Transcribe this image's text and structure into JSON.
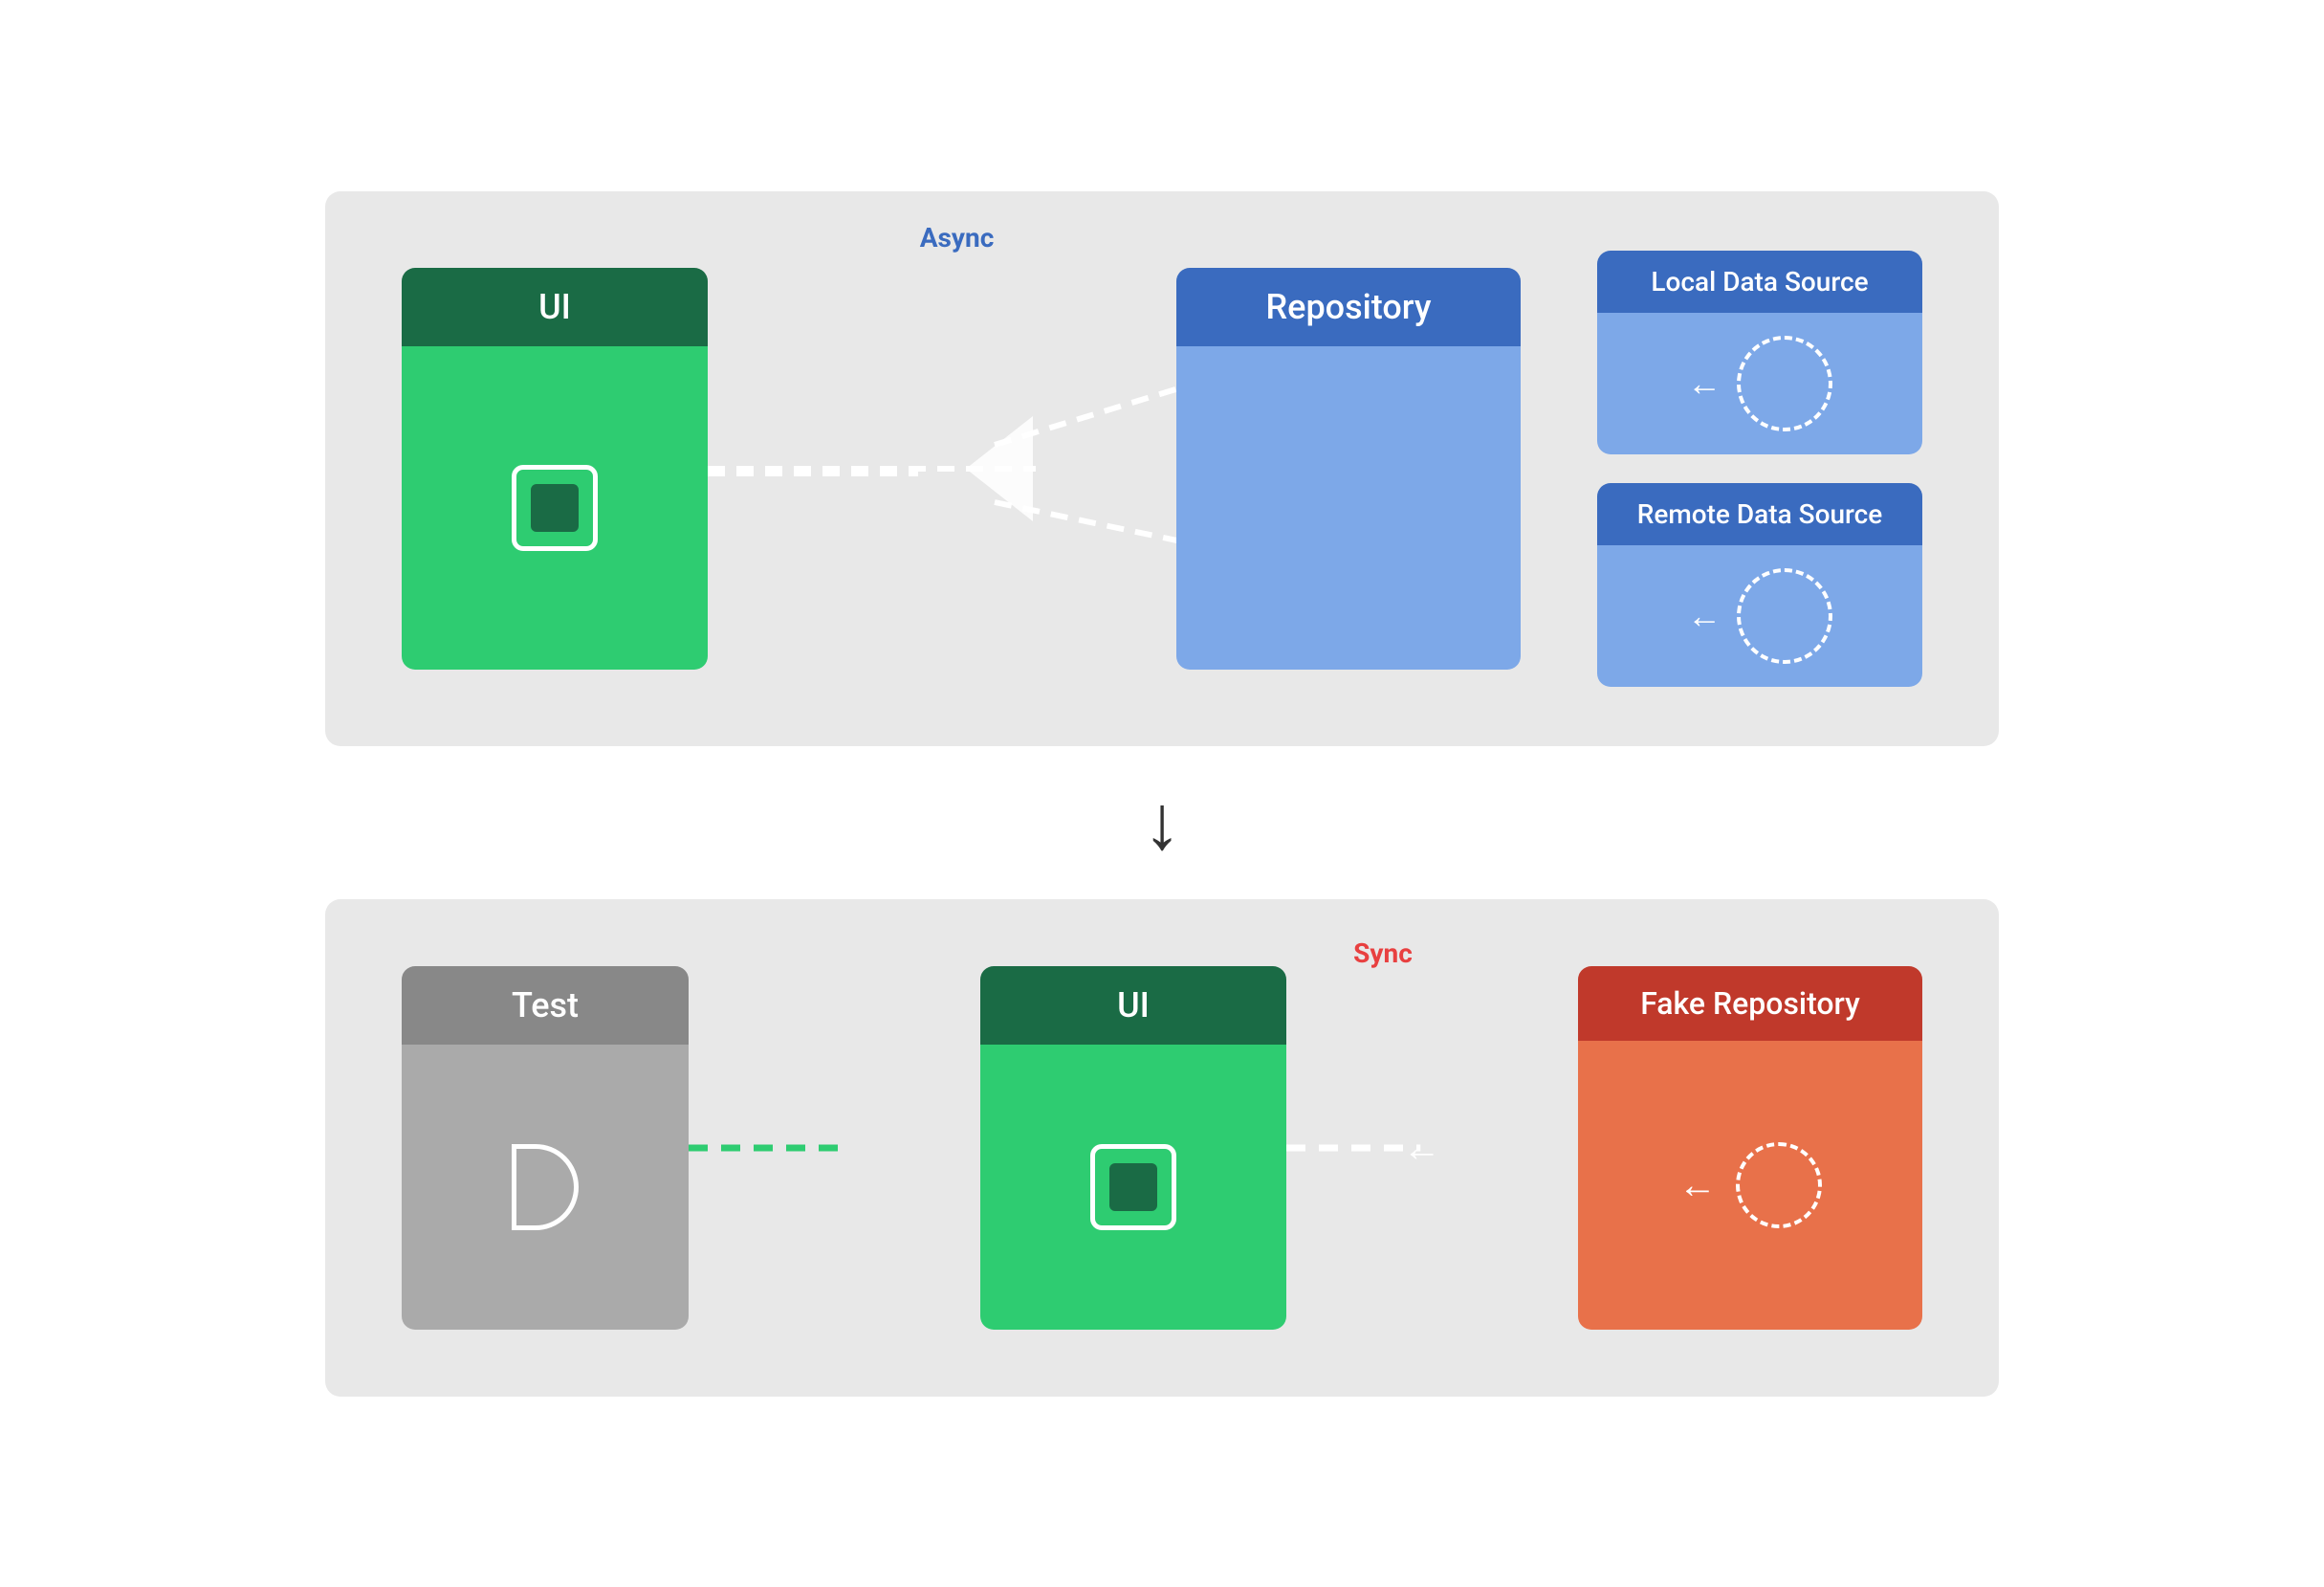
{
  "top_diagram": {
    "ui_label": "UI",
    "repo_label": "Repository",
    "local_ds_label": "Local Data Source",
    "remote_ds_label": "Remote Data Source",
    "async_label": "Async"
  },
  "bottom_diagram": {
    "test_label": "Test",
    "ui_label": "UI",
    "fake_repo_label": "Fake Repository",
    "sync_label": "Sync"
  },
  "down_arrow": "↓"
}
